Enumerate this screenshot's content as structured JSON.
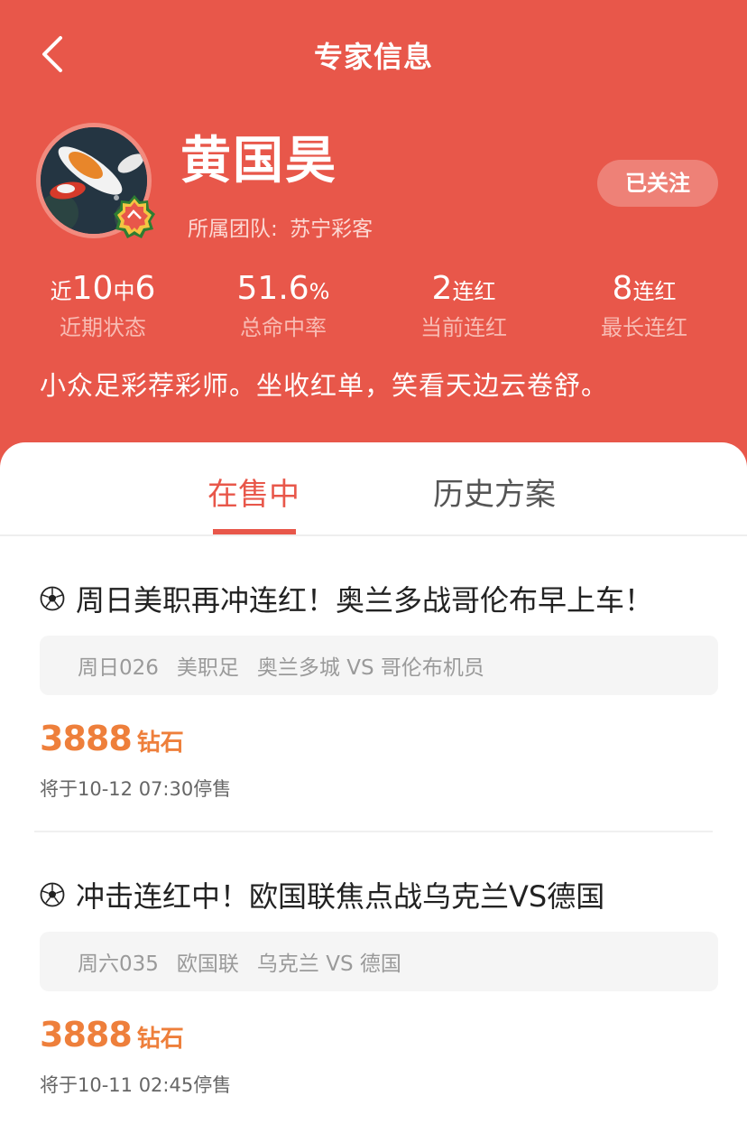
{
  "nav": {
    "title": "专家信息",
    "back_icon": "chevron-left-icon"
  },
  "expert": {
    "name": "黄国昊",
    "team_label": "所属团队:",
    "team_name": "苏宁彩客",
    "follow_label": "已关注",
    "intro": "小众足彩荐彩师。坐收红单，笑看天边云卷舒。"
  },
  "stats": {
    "recent": {
      "pre": "近",
      "num1": "10",
      "mid": "中",
      "num2": "6",
      "label": "近期状态"
    },
    "hit_rate": {
      "value": "51.6",
      "unit": "%",
      "label": "总命中率"
    },
    "current_streak": {
      "value": "2",
      "unit": "连红",
      "label": "当前连红"
    },
    "longest_streak": {
      "value": "8",
      "unit": "连红",
      "label": "最长连红"
    }
  },
  "tabs": [
    {
      "label": "在售中",
      "active": true
    },
    {
      "label": "历史方案",
      "active": false
    }
  ],
  "plans": [
    {
      "title": "周日美职再冲连红！奥兰多战哥伦布早上车！",
      "match_code": "周日026",
      "league": "美职足",
      "teams": "奥兰多城 VS 哥伦布机员",
      "price": "3888",
      "price_unit": "钻石",
      "stop_time": "将于10-12 07:30停售"
    },
    {
      "title": "冲击连红中！欧国联焦点战乌克兰VS德国",
      "match_code": "周六035",
      "league": "欧国联",
      "teams": "乌克兰 VS 德国",
      "price": "3888",
      "price_unit": "钻石",
      "stop_time": "将于10-11 02:45停售"
    }
  ],
  "colors": {
    "header_bg": "#E8574A",
    "accent": "#E8574A",
    "price": "#EE7F3B"
  }
}
